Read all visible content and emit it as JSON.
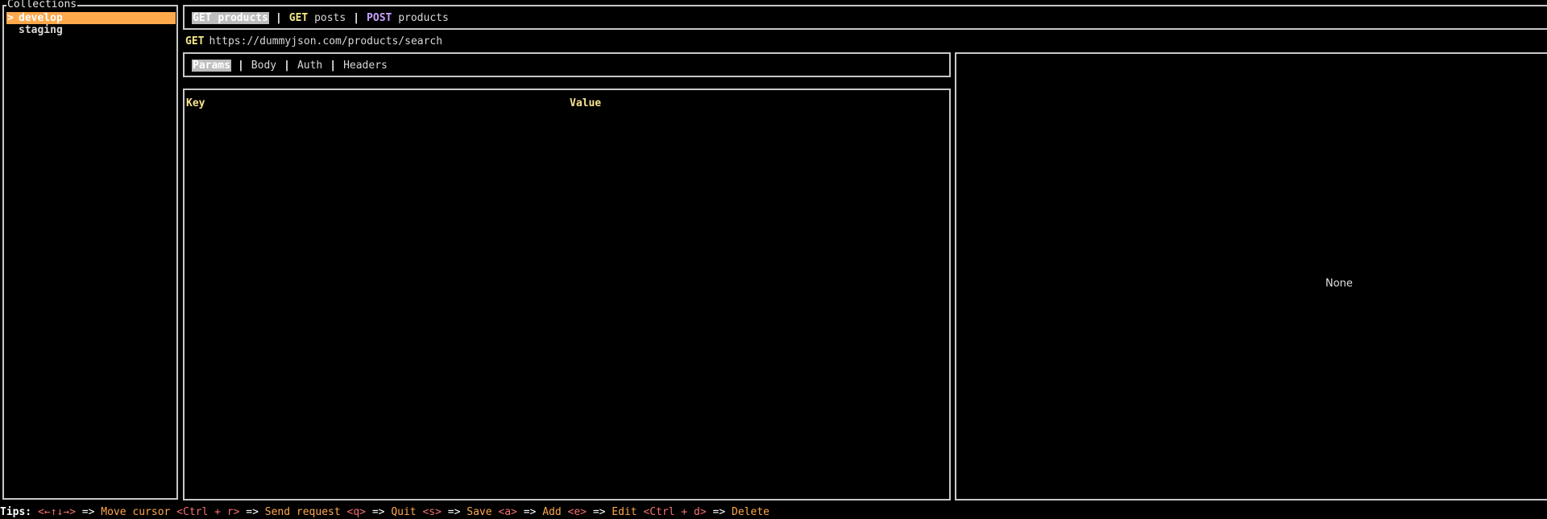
{
  "sidebar": {
    "title": "Collections",
    "marker": ">",
    "items": [
      {
        "label": "develop"
      },
      {
        "label": "staging"
      }
    ]
  },
  "request_tabs": [
    {
      "method": "GET",
      "name": "products"
    },
    {
      "method": "GET",
      "name": "posts"
    },
    {
      "method": "POST",
      "name": "products"
    }
  ],
  "request_tab_separator": "|",
  "url": {
    "method": "GET",
    "value": "https://dummyjson.com/products/search"
  },
  "param_tabs": [
    "Params",
    "Body",
    "Auth",
    "Headers"
  ],
  "params_table": {
    "columns": [
      "Key",
      "Value"
    ]
  },
  "response": {
    "body": "None"
  },
  "tips": {
    "label": "Tips:",
    "entries": [
      {
        "key": "<←↑↓→>",
        "arrow": "=>",
        "action": "Move cursor"
      },
      {
        "key": "<Ctrl + r>",
        "arrow": "=>",
        "action": "Send request"
      },
      {
        "key": "<q>",
        "arrow": "=>",
        "action": "Quit"
      },
      {
        "key": "<s>",
        "arrow": "=>",
        "action": "Save"
      },
      {
        "key": "<a>",
        "arrow": "=>",
        "action": "Add"
      },
      {
        "key": "<e>",
        "arrow": "=>",
        "action": "Edit"
      },
      {
        "key": "<Ctrl + d>",
        "arrow": "=>",
        "action": "Delete"
      }
    ]
  },
  "colors": {
    "accent": "#ffa94d",
    "get_method": "#f5e98a",
    "post_method": "#c9a3ff",
    "column_header": "#f7e38c",
    "key_hint": "#f47070",
    "border": "#c8c8c8"
  }
}
